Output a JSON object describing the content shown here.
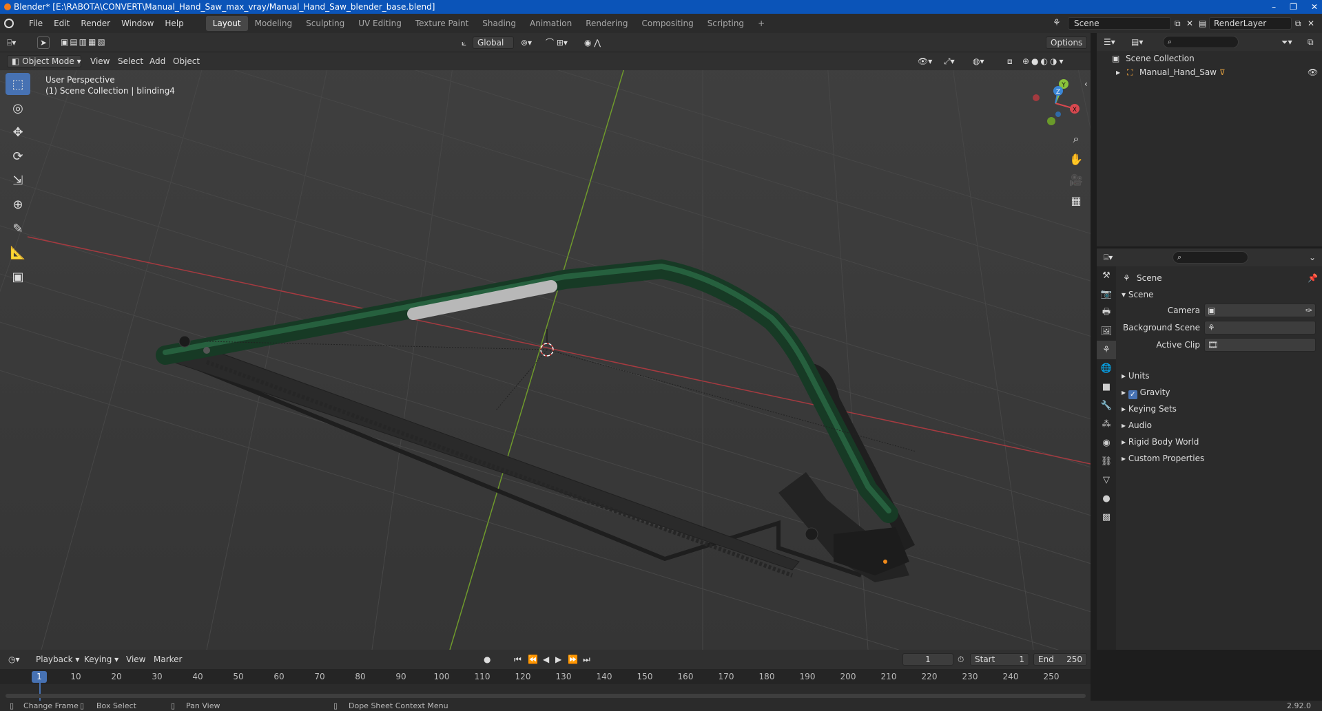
{
  "title_bar": {
    "text": "Blender* [E:\\RABOTA\\CONVERT\\Manual_Hand_Saw_max_vray/Manual_Hand_Saw_blender_base.blend]",
    "controls": [
      "–",
      "❐",
      "✕"
    ]
  },
  "menu": {
    "items": [
      "File",
      "Edit",
      "Render",
      "Window",
      "Help"
    ]
  },
  "workspaces": {
    "active": "Layout",
    "tabs": [
      "Layout",
      "Modeling",
      "Sculpting",
      "UV Editing",
      "Texture Paint",
      "Shading",
      "Animation",
      "Rendering",
      "Compositing",
      "Scripting"
    ],
    "add": "+"
  },
  "scene_selector": {
    "value": "Scene"
  },
  "render_layer": {
    "value": "RenderLayer"
  },
  "viewport_header": {
    "transform_orientation": "Global",
    "options_label": "Options",
    "mode": "Object Mode",
    "menus": [
      "View",
      "Select",
      "Add",
      "Object"
    ]
  },
  "viewport": {
    "info_line1": "User Perspective",
    "info_line2": "(1) Scene Collection | blinding4",
    "gizmo_axes": [
      "X",
      "Y",
      "Z"
    ]
  },
  "outliner": {
    "root": "Scene Collection",
    "items": [
      {
        "label": "Manual_Hand_Saw"
      }
    ]
  },
  "properties": {
    "context_title": "Scene",
    "panel_title": "Scene",
    "fields": [
      {
        "label": "Camera",
        "value": ""
      },
      {
        "label": "Background Scene",
        "value": ""
      },
      {
        "label": "Active Clip",
        "value": ""
      }
    ],
    "sections": [
      {
        "label": "Units",
        "checkbox": false
      },
      {
        "label": "Gravity",
        "checkbox": true
      },
      {
        "label": "Keying Sets",
        "checkbox": false
      },
      {
        "label": "Audio",
        "checkbox": false
      },
      {
        "label": "Rigid Body World",
        "checkbox": false
      },
      {
        "label": "Custom Properties",
        "checkbox": false
      }
    ]
  },
  "timeline": {
    "menus": [
      "Playback",
      "Keying",
      "View",
      "Marker"
    ],
    "current_frame": "1",
    "start_label": "Start",
    "start": "1",
    "end_label": "End",
    "end": "250",
    "ruler": [
      "1",
      "10",
      "20",
      "30",
      "40",
      "50",
      "60",
      "70",
      "80",
      "90",
      "100",
      "110",
      "120",
      "130",
      "140",
      "150",
      "160",
      "170",
      "180",
      "190",
      "200",
      "210",
      "220",
      "230",
      "240",
      "250"
    ]
  },
  "status_bar": {
    "items": [
      "Change Frame",
      "Box Select",
      "Pan View",
      "Dope Sheet Context Menu"
    ],
    "version": "2.92.0"
  },
  "colors": {
    "accent": "#4772b3",
    "title_bar": "#0b54b8",
    "saw_frame": "#1d4a30",
    "x_axis": "#d8484f",
    "y_axis": "#8ac23b",
    "z_axis": "#3a86d6"
  }
}
